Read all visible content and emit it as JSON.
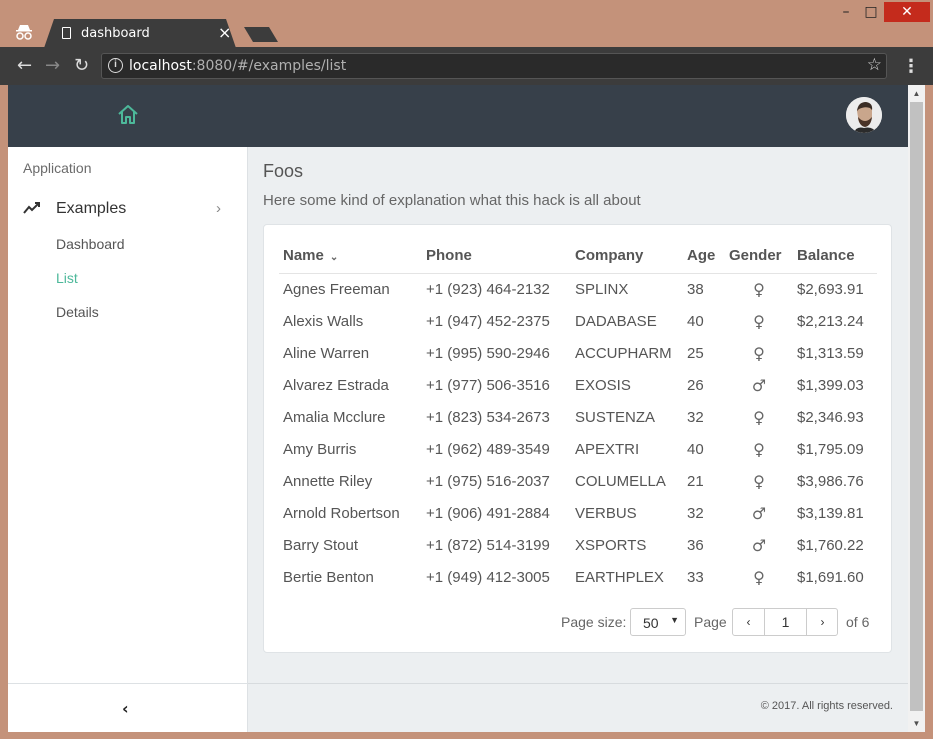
{
  "browser": {
    "tab_title": "dashboard",
    "tab_close": "×",
    "url_host": "localhost",
    "url_rest": ":8080/#/examples/list",
    "window_buttons": {
      "minimize": "–",
      "maximize": "□",
      "close": "✕"
    }
  },
  "sidebar": {
    "section": "Application",
    "group_label": "Examples",
    "items": [
      {
        "label": "Dashboard",
        "active": false
      },
      {
        "label": "List",
        "active": true
      },
      {
        "label": "Details",
        "active": false
      }
    ],
    "collapse_icon": "‹"
  },
  "main": {
    "title": "Foos",
    "subtitle": "Here some kind of explanation what this hack is all about"
  },
  "table": {
    "columns": [
      "Name",
      "Phone",
      "Company",
      "Age",
      "Gender",
      "Balance"
    ],
    "rows": [
      [
        "Agnes Freeman",
        "+1 (923) 464-2132",
        "SPLINX",
        "38",
        "♀",
        "$2,693.91"
      ],
      [
        "Alexis Walls",
        "+1 (947) 452-2375",
        "DADABASE",
        "40",
        "♀",
        "$2,213.24"
      ],
      [
        "Aline Warren",
        "+1 (995) 590-2946",
        "ACCUPHARM",
        "25",
        "♀",
        "$1,313.59"
      ],
      [
        "Alvarez Estrada",
        "+1 (977) 506-3516",
        "EXOSIS",
        "26",
        "♂",
        "$1,399.03"
      ],
      [
        "Amalia Mcclure",
        "+1 (823) 534-2673",
        "SUSTENZA",
        "32",
        "♀",
        "$2,346.93"
      ],
      [
        "Amy Burris",
        "+1 (962) 489-3549",
        "APEXTRI",
        "40",
        "♀",
        "$1,795.09"
      ],
      [
        "Annette Riley",
        "+1 (975) 516-2037",
        "COLUMELLA",
        "21",
        "♀",
        "$3,986.76"
      ],
      [
        "Arnold Robertson",
        "+1 (906) 491-2884",
        "VERBUS",
        "32",
        "♂",
        "$3,139.81"
      ],
      [
        "Barry Stout",
        "+1 (872) 514-3199",
        "XSPORTS",
        "36",
        "♂",
        "$1,760.22"
      ],
      [
        "Bertie Benton",
        "+1 (949) 412-3005",
        "EARTHPLEX",
        "33",
        "♀",
        "$1,691.60"
      ]
    ]
  },
  "pager": {
    "page_size_label": "Page size:",
    "page_size": "50",
    "page_label": "Page",
    "current_page": "1",
    "of_label": "of 6",
    "prev": "‹",
    "next": "›"
  },
  "footer": {
    "copyright": "© 2017. All rights reserved."
  },
  "colors": {
    "accent": "#4db89a",
    "appbar": "#37404a",
    "background": "#eceff1"
  }
}
